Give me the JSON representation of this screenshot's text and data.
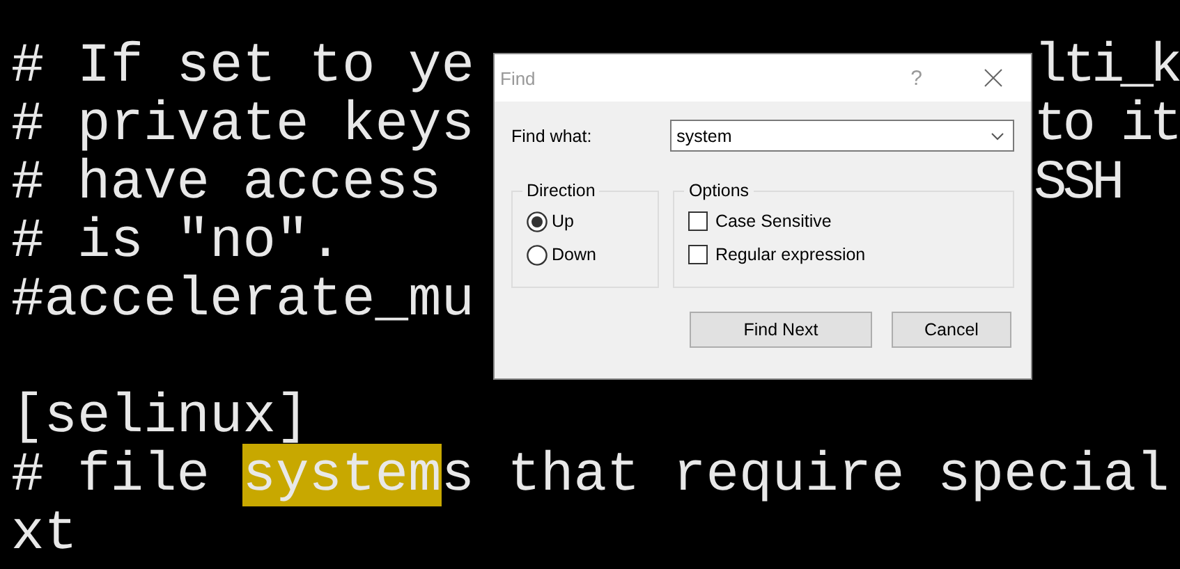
{
  "editor": {
    "lines": [
      {
        "segments": [
          {
            "text": "# If set to ye",
            "highlighted": false
          }
        ],
        "right": "lti_k"
      },
      {
        "segments": [
          {
            "text": "# private keys",
            "highlighted": false
          }
        ],
        "right": "to it"
      },
      {
        "segments": [
          {
            "text": "# have access",
            "highlighted": false
          }
        ],
        "right": "SSH"
      },
      {
        "segments": [
          {
            "text": "# is \"no\".",
            "highlighted": false
          }
        ]
      },
      {
        "segments": [
          {
            "text": "#accelerate_mu",
            "highlighted": false
          }
        ]
      },
      {
        "segments": [
          {
            "text": "[selinux]",
            "highlighted": false
          }
        ],
        "blank_line_before": true
      },
      {
        "segments": [
          {
            "text": "# file ",
            "highlighted": false
          },
          {
            "text": "system",
            "highlighted": true
          },
          {
            "text": "s that require special",
            "highlighted": false
          }
        ]
      },
      {
        "segments": [
          {
            "text": "xt",
            "highlighted": false
          }
        ]
      }
    ]
  },
  "dialog": {
    "title": "Find",
    "help": "?",
    "find_label": "Find what:",
    "find_value": "system",
    "direction": {
      "title": "Direction",
      "options": [
        {
          "label": "Up",
          "selected": true
        },
        {
          "label": "Down",
          "selected": false
        }
      ]
    },
    "options": {
      "title": "Options",
      "items": [
        {
          "label": "Case Sensitive",
          "checked": false
        },
        {
          "label": "Regular expression",
          "checked": false
        }
      ]
    },
    "buttons": [
      {
        "label": "Find Next",
        "kind": "default"
      },
      {
        "label": "Cancel",
        "kind": "normal"
      }
    ]
  }
}
